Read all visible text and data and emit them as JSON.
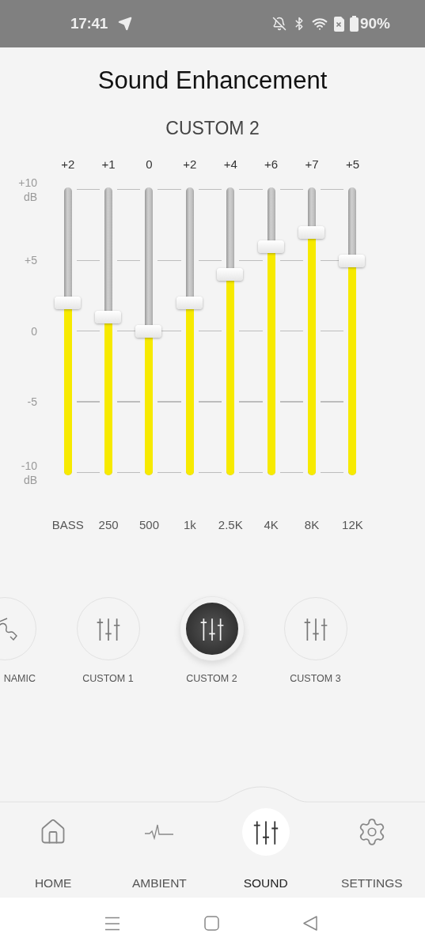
{
  "status_bar": {
    "time": "17:41",
    "battery": "90%"
  },
  "title": "Sound Enhancement",
  "preset_name": "CUSTOM 2",
  "equalizer": {
    "axis_labels": [
      "+10 dB",
      "+5",
      "0",
      "-5",
      "-10 dB"
    ],
    "bands": [
      {
        "label": "BASS",
        "reading": "+2",
        "level": 0.6
      },
      {
        "label": "250",
        "reading": "+1",
        "level": 0.55
      },
      {
        "label": "500",
        "reading": "0",
        "level": 0.5
      },
      {
        "label": "1k",
        "reading": "+2",
        "level": 0.6
      },
      {
        "label": "2.5K",
        "reading": "+4",
        "level": 0.7
      },
      {
        "label": "4K",
        "reading": "+6",
        "level": 0.8
      },
      {
        "label": "8K",
        "reading": "+7",
        "level": 0.85
      },
      {
        "label": "12K",
        "reading": "+5",
        "level": 0.75
      }
    ]
  },
  "presets": [
    {
      "label": "NAMIC",
      "kind": "curve",
      "selected": false
    },
    {
      "label": "CUSTOM 1",
      "kind": "sliders",
      "selected": false
    },
    {
      "label": "CUSTOM 2",
      "kind": "sliders",
      "selected": true
    },
    {
      "label": "CUSTOM 3",
      "kind": "sliders",
      "selected": false
    }
  ],
  "nav": [
    {
      "label": "HOME",
      "kind": "home",
      "selected": false
    },
    {
      "label": "AMBIENT",
      "kind": "pulse",
      "selected": false
    },
    {
      "label": "SOUND",
      "kind": "sliders",
      "selected": true
    },
    {
      "label": "SETTINGS",
      "kind": "settings",
      "selected": false
    }
  ]
}
